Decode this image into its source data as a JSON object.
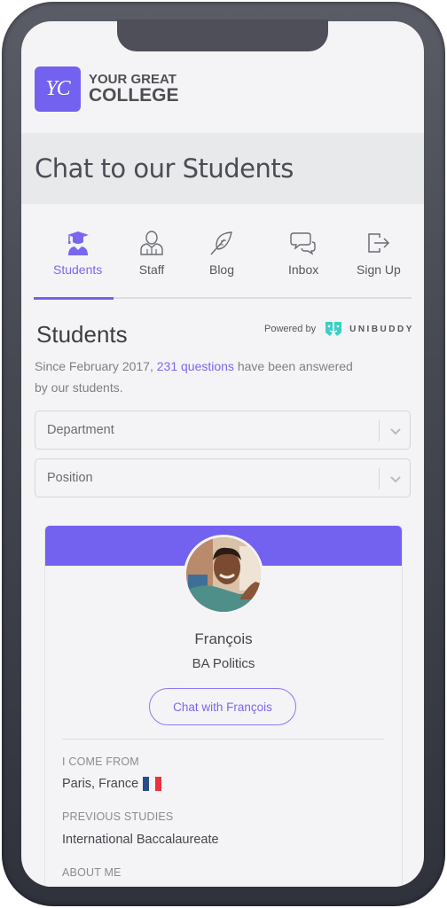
{
  "brand": {
    "logo_initials": "YC",
    "name_line1": "YOUR GREAT",
    "name_line2": "COLLEGE",
    "accent_color": "#7361f0"
  },
  "page": {
    "title": "Chat to our Students"
  },
  "tabs": [
    {
      "label": "Students",
      "icon": "graduate-icon",
      "active": true
    },
    {
      "label": "Staff",
      "icon": "person-icon",
      "active": false
    },
    {
      "label": "Blog",
      "icon": "feather-icon",
      "active": false
    },
    {
      "label": "Inbox",
      "icon": "chat-bubbles-icon",
      "active": false
    },
    {
      "label": "Sign Up",
      "icon": "sign-out-icon",
      "active": false
    }
  ],
  "section": {
    "title": "Students",
    "powered_by": "Powered by",
    "provider": "UNIBUDDY",
    "provider_color": "#3ccfc7",
    "intro_before": "Since February 2017, ",
    "intro_link": "231 questions",
    "intro_after": " have been answered by our students."
  },
  "filters": {
    "department": {
      "placeholder": "Department"
    },
    "position": {
      "placeholder": "Position"
    }
  },
  "profile": {
    "name": "François",
    "course": "BA Politics",
    "chat_button": "Chat with François",
    "fields": [
      {
        "label": "I COME FROM",
        "value": "Paris, France",
        "flag": "France"
      },
      {
        "label": "PREVIOUS STUDIES",
        "value": "International Baccalaureate"
      },
      {
        "label": "ABOUT ME",
        "value": ""
      }
    ]
  }
}
